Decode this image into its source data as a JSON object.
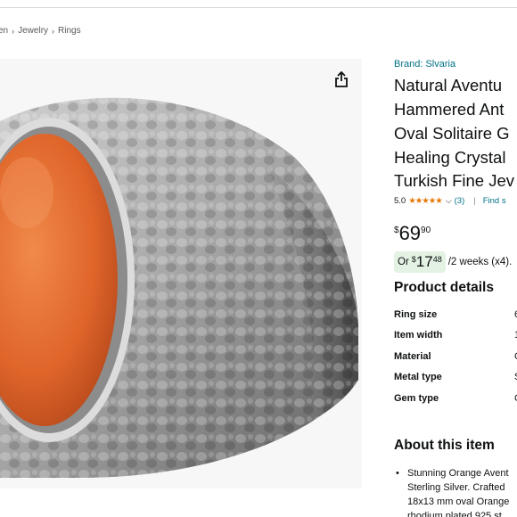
{
  "breadcrumb": [
    "en",
    "Jewelry",
    "Rings"
  ],
  "product": {
    "brand": "Brand: Slvaria",
    "title_lines": [
      "Natural Aventu",
      "Hammered Ant",
      "Oval Solitaire G",
      "Healing Crystal",
      "Turkish Fine Jev"
    ],
    "rating": "5.0",
    "stars": "★★★★★",
    "review_count": "(3)",
    "divider": "|",
    "find_link": "Find s",
    "price": {
      "symbol": "$",
      "whole": "69",
      "fraction": "90"
    },
    "installment": {
      "prefix": "Or",
      "symbol": "$",
      "whole": "17",
      "fraction": "48",
      "suffix": "/2 weeks (x4)."
    }
  },
  "details": {
    "heading": "Product details",
    "rows": [
      {
        "label": "Ring size",
        "value": "6"
      },
      {
        "label": "Item width",
        "value": "1"
      },
      {
        "label": "Material",
        "value": "C"
      },
      {
        "label": "Metal type",
        "value": "S"
      },
      {
        "label": "Gem type",
        "value": "C"
      }
    ]
  },
  "about": {
    "heading": "About this item",
    "bullet": "•",
    "lines": [
      "Stunning Orange Avent",
      "Sterling Silver. Crafted",
      "18x13 mm oval Orange",
      "rhodium plated 925 st"
    ]
  },
  "colors": {
    "link": "#007185",
    "star": "#e77600",
    "install_bg": "#e3f2e3",
    "gem": "#e8682a"
  },
  "icons": {
    "share": "share-icon",
    "breadcrumb_separator": "chevron-right-icon",
    "rating_dropdown": "chevron-down-icon"
  }
}
